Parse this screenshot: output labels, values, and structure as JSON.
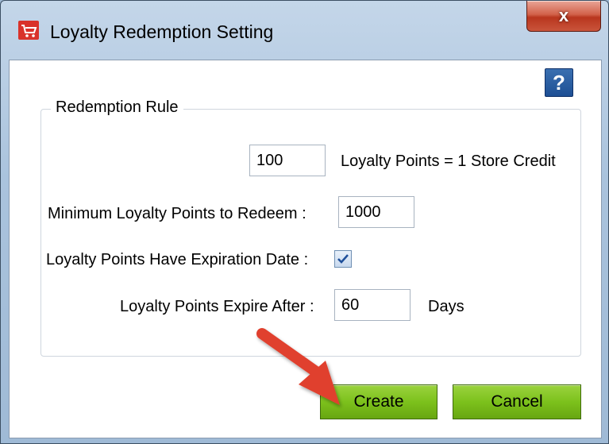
{
  "window": {
    "title": "Loyalty Redemption Setting",
    "close_label": "x"
  },
  "help": {
    "label": "?"
  },
  "redemption_rule": {
    "group_title": "Redemption Rule",
    "points_per_credit_value": "100",
    "points_per_credit_label": "Loyalty Points  = 1 Store Credit",
    "min_points_label": "Minimum Loyalty Points to Redeem  :",
    "min_points_value": "1000",
    "expiration_label": "Loyalty Points Have Expiration Date :",
    "expiration_checked": true,
    "expire_after_label": "Loyalty Points Expire After :",
    "expire_after_value": "60",
    "expire_after_unit": "Days"
  },
  "buttons": {
    "create": "Create",
    "cancel": "Cancel"
  },
  "colors": {
    "button_green": "#7cc11c",
    "close_red": "#c9543b",
    "arrow_red": "#e0402e",
    "help_blue": "#1d4f94"
  }
}
